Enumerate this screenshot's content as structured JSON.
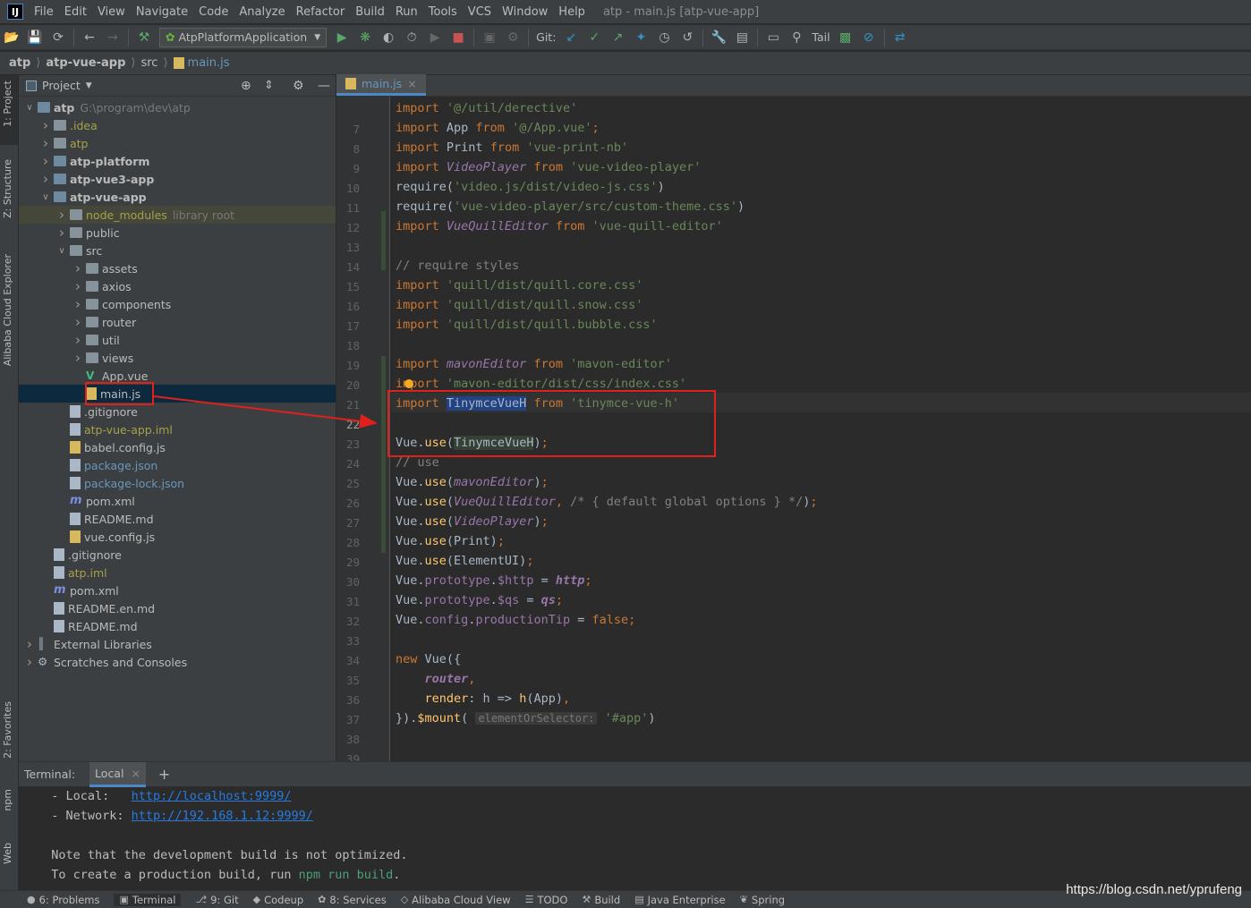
{
  "menubar": {
    "logo": "IJ",
    "items": [
      "File",
      "Edit",
      "View",
      "Navigate",
      "Code",
      "Analyze",
      "Refactor",
      "Build",
      "Run",
      "Tools",
      "VCS",
      "Window",
      "Help"
    ],
    "window_title": "atp - main.js [atp-vue-app]"
  },
  "toolbar": {
    "run_config": "AtpPlatformApplication",
    "git_label": "Git:",
    "tail_label": "Tail"
  },
  "breadcrumb": [
    "atp",
    "atp-vue-app",
    "src",
    "main.js"
  ],
  "left_strip": {
    "project": "1: Project",
    "structure": "Z: Structure",
    "alibaba": "Alibaba Cloud Explorer",
    "favorites": "2: Favorites",
    "npm": "npm",
    "web": "Web"
  },
  "project_panel": {
    "title": "Project",
    "tree": [
      {
        "label": "atp",
        "extra": "G:\\program\\dev\\atp",
        "depth": 0,
        "open": true,
        "type": "module",
        "bold": true
      },
      {
        "label": ".idea",
        "depth": 1,
        "type": "folder",
        "color": "#a6a04a"
      },
      {
        "label": "atp",
        "depth": 1,
        "type": "folder",
        "color": "#a6a04a"
      },
      {
        "label": "atp-platform",
        "depth": 1,
        "type": "module",
        "bold": true
      },
      {
        "label": "atp-vue3-app",
        "depth": 1,
        "type": "module",
        "bold": true
      },
      {
        "label": "atp-vue-app",
        "depth": 1,
        "open": true,
        "type": "module",
        "bold": true
      },
      {
        "label": "node_modules",
        "extra": "library root",
        "depth": 2,
        "type": "folder",
        "color": "#a6a04a",
        "shaded": true
      },
      {
        "label": "public",
        "depth": 2,
        "type": "folder"
      },
      {
        "label": "src",
        "depth": 2,
        "open": true,
        "type": "folder"
      },
      {
        "label": "assets",
        "depth": 3,
        "type": "folder"
      },
      {
        "label": "axios",
        "depth": 3,
        "type": "folder"
      },
      {
        "label": "components",
        "depth": 3,
        "type": "folder"
      },
      {
        "label": "router",
        "depth": 3,
        "type": "folder"
      },
      {
        "label": "util",
        "depth": 3,
        "type": "folder"
      },
      {
        "label": "views",
        "depth": 3,
        "type": "folder"
      },
      {
        "label": "App.vue",
        "depth": 3,
        "type": "vue",
        "leaf": true
      },
      {
        "label": "main.js",
        "depth": 3,
        "type": "js",
        "leaf": true,
        "selected": true
      },
      {
        "label": ".gitignore",
        "depth": 2,
        "type": "file",
        "leaf": true
      },
      {
        "label": "atp-vue-app.iml",
        "depth": 2,
        "type": "file",
        "leaf": true,
        "color": "#a6a04a"
      },
      {
        "label": "babel.config.js",
        "depth": 2,
        "type": "js",
        "leaf": true
      },
      {
        "label": "package.json",
        "depth": 2,
        "type": "file",
        "leaf": true,
        "color": "#6897bb"
      },
      {
        "label": "package-lock.json",
        "depth": 2,
        "type": "file",
        "leaf": true,
        "color": "#6897bb"
      },
      {
        "label": "pom.xml",
        "depth": 2,
        "type": "maven",
        "leaf": true
      },
      {
        "label": "README.md",
        "depth": 2,
        "type": "file",
        "leaf": true
      },
      {
        "label": "vue.config.js",
        "depth": 2,
        "type": "js",
        "leaf": true
      },
      {
        "label": ".gitignore",
        "depth": 1,
        "type": "file",
        "leaf": true
      },
      {
        "label": "atp.iml",
        "depth": 1,
        "type": "file",
        "leaf": true,
        "color": "#a6a04a"
      },
      {
        "label": "pom.xml",
        "depth": 1,
        "type": "maven",
        "leaf": true
      },
      {
        "label": "README.en.md",
        "depth": 1,
        "type": "file",
        "leaf": true
      },
      {
        "label": "README.md",
        "depth": 1,
        "type": "file",
        "leaf": true
      },
      {
        "label": "External Libraries",
        "depth": 0,
        "type": "lib"
      },
      {
        "label": "Scratches and Consoles",
        "depth": 0,
        "type": "scratch"
      }
    ]
  },
  "editor": {
    "tab": "main.js",
    "lines": [
      {
        "n": "7",
        "parts": [
          [
            "kw",
            "import "
          ],
          [
            "str",
            "'@/util/derective'"
          ]
        ]
      },
      {
        "n": "8",
        "parts": [
          [
            "kw",
            "import "
          ],
          [
            "",
            "App "
          ],
          [
            "kw",
            "from "
          ],
          [
            "str",
            "'@/App.vue'"
          ],
          [
            "kw",
            ";"
          ]
        ]
      },
      {
        "n": "9",
        "parts": [
          [
            "kw",
            "import "
          ],
          [
            "",
            "Print "
          ],
          [
            "kw",
            "from "
          ],
          [
            "str",
            "'vue-print-nb'"
          ]
        ]
      },
      {
        "n": "10",
        "parts": [
          [
            "kw",
            "import "
          ],
          [
            "it",
            "VideoPlayer "
          ],
          [
            "kw",
            "from "
          ],
          [
            "str",
            "'vue-video-player'"
          ]
        ]
      },
      {
        "n": "11",
        "parts": [
          [
            "",
            "require("
          ],
          [
            "str",
            "'video.js/dist/video-js.css'"
          ],
          [
            "",
            ")"
          ]
        ]
      },
      {
        "n": "12",
        "parts": [
          [
            "",
            "require("
          ],
          [
            "str",
            "'vue-video-player/src/custom-theme.css'"
          ],
          [
            "",
            ")"
          ]
        ]
      },
      {
        "n": "13",
        "parts": [
          [
            "kw",
            "import "
          ],
          [
            "it",
            "VueQuillEditor "
          ],
          [
            "kw",
            "from "
          ],
          [
            "str",
            "'vue-quill-editor'"
          ]
        ]
      },
      {
        "n": "14",
        "parts": []
      },
      {
        "n": "15",
        "parts": [
          [
            "cm",
            "// require styles"
          ]
        ]
      },
      {
        "n": "16",
        "parts": [
          [
            "kw",
            "import "
          ],
          [
            "str",
            "'quill/dist/quill.core.css'"
          ]
        ]
      },
      {
        "n": "17",
        "parts": [
          [
            "kw",
            "import "
          ],
          [
            "str",
            "'quill/dist/quill.snow.css'"
          ]
        ]
      },
      {
        "n": "18",
        "parts": [
          [
            "kw",
            "import "
          ],
          [
            "str",
            "'quill/dist/quill.bubble.css'"
          ]
        ]
      },
      {
        "n": "19",
        "parts": []
      },
      {
        "n": "20",
        "parts": [
          [
            "kw",
            "import "
          ],
          [
            "it",
            "mavonEditor "
          ],
          [
            "kw",
            "from "
          ],
          [
            "str",
            "'mavon-editor'"
          ]
        ]
      },
      {
        "n": "21",
        "parts": [
          [
            "kw",
            "import "
          ],
          [
            "str",
            "'mavon-editor/dist/css/index.css'"
          ]
        ]
      },
      {
        "n": "22",
        "parts": [
          [
            "kw",
            "import "
          ],
          [
            "sel",
            "TinymceVueH"
          ],
          [
            "",
            " "
          ],
          [
            "kw",
            "from "
          ],
          [
            "str",
            "'tinymce-vue-h'"
          ]
        ]
      },
      {
        "n": "23",
        "parts": []
      },
      {
        "n": "24",
        "parts": [
          [
            "",
            "Vue."
          ],
          [
            "fn",
            "use"
          ],
          [
            "",
            "("
          ],
          [
            "hl",
            "TinymceVueH"
          ],
          [
            "",
            ")"
          ],
          [
            "kw",
            ";"
          ]
        ]
      },
      {
        "n": "25",
        "parts": [
          [
            "cm",
            "// use"
          ]
        ]
      },
      {
        "n": "26",
        "parts": [
          [
            "",
            "Vue."
          ],
          [
            "fn",
            "use"
          ],
          [
            "",
            "("
          ],
          [
            "it",
            "mavonEditor"
          ],
          [
            "",
            ")"
          ],
          [
            "kw",
            ";"
          ]
        ]
      },
      {
        "n": "27",
        "parts": [
          [
            "",
            "Vue."
          ],
          [
            "fn",
            "use"
          ],
          [
            "",
            "("
          ],
          [
            "it",
            "VueQuillEditor"
          ],
          [
            "kw",
            ", "
          ],
          [
            "cm",
            "/* { default global options } */"
          ],
          [
            "",
            ")"
          ],
          [
            "kw",
            ";"
          ]
        ]
      },
      {
        "n": "28",
        "parts": [
          [
            "",
            "Vue."
          ],
          [
            "fn",
            "use"
          ],
          [
            "",
            "("
          ],
          [
            "it",
            "VideoPlayer"
          ],
          [
            "",
            ")"
          ],
          [
            "kw",
            ";"
          ]
        ]
      },
      {
        "n": "29",
        "parts": [
          [
            "",
            "Vue."
          ],
          [
            "fn",
            "use"
          ],
          [
            "",
            "(Print)"
          ],
          [
            "kw",
            ";"
          ]
        ]
      },
      {
        "n": "30",
        "parts": [
          [
            "",
            "Vue."
          ],
          [
            "fn",
            "use"
          ],
          [
            "",
            "(ElementUI)"
          ],
          [
            "kw",
            ";"
          ]
        ]
      },
      {
        "n": "31",
        "parts": [
          [
            "",
            "Vue."
          ],
          [
            "pr",
            "prototype"
          ],
          [
            "",
            "."
          ],
          [
            "pr",
            "$http"
          ],
          [
            "",
            " = "
          ],
          [
            "itb",
            "http"
          ],
          [
            "kw",
            ";"
          ]
        ]
      },
      {
        "n": "32",
        "parts": [
          [
            "",
            "Vue."
          ],
          [
            "pr",
            "prototype"
          ],
          [
            "",
            "."
          ],
          [
            "pr",
            "$qs"
          ],
          [
            "",
            " = "
          ],
          [
            "itb",
            "qs"
          ],
          [
            "kw",
            ";"
          ]
        ]
      },
      {
        "n": "33",
        "parts": [
          [
            "",
            "Vue."
          ],
          [
            "pr",
            "config"
          ],
          [
            "",
            "."
          ],
          [
            "pr",
            "productionTip"
          ],
          [
            "",
            " = "
          ],
          [
            "kw",
            "false;"
          ]
        ]
      },
      {
        "n": "34",
        "parts": []
      },
      {
        "n": "35",
        "parts": [
          [
            "kw",
            "new "
          ],
          [
            "",
            "Vue({"
          ]
        ]
      },
      {
        "n": "36",
        "parts": [
          [
            "",
            "    "
          ],
          [
            "itb",
            "router"
          ],
          [
            "kw",
            ","
          ]
        ]
      },
      {
        "n": "37",
        "parts": [
          [
            "",
            "    "
          ],
          [
            "fn",
            "render"
          ],
          [
            "",
            ": h => "
          ],
          [
            "fn",
            "h"
          ],
          [
            "",
            "(App)"
          ],
          [
            "kw",
            ","
          ]
        ]
      },
      {
        "n": "38",
        "parts": [
          [
            "",
            "})."
          ],
          [
            "fn",
            "$mount"
          ],
          [
            "",
            "( "
          ],
          [
            "hint",
            "elementOrSelector:"
          ],
          [
            "",
            " "
          ],
          [
            "str",
            "'#app'"
          ],
          [
            "",
            ")"
          ]
        ]
      },
      {
        "n": "39",
        "parts": []
      }
    ]
  },
  "terminal": {
    "label": "Terminal:",
    "tab": "Local",
    "lines": [
      {
        "prefix": "  - Local:   ",
        "link": "http://localhost:9999/"
      },
      {
        "prefix": "  - Network: ",
        "link": "http://192.168.1.12:9999/"
      },
      {
        "text": ""
      },
      {
        "text": "  Note that the development build is not optimized."
      },
      {
        "prefix": "  To create a production build, run ",
        "green": "npm run build",
        "suffix": "."
      }
    ]
  },
  "statusbar": [
    {
      "icon": "●",
      "label": "6: Problems"
    },
    {
      "icon": "▣",
      "label": "Terminal"
    },
    {
      "icon": "⎇",
      "label": "9: Git"
    },
    {
      "icon": "◆",
      "label": "Codeup"
    },
    {
      "icon": "✿",
      "label": "8: Services"
    },
    {
      "icon": "◇",
      "label": "Alibaba Cloud View"
    },
    {
      "icon": "☰",
      "label": "TODO"
    },
    {
      "icon": "⚒",
      "label": "Build"
    },
    {
      "icon": "▤",
      "label": "Java Enterprise"
    },
    {
      "icon": "❦",
      "label": "Spring"
    }
  ],
  "watermark": "https://blog.csdn.net/yprufeng"
}
